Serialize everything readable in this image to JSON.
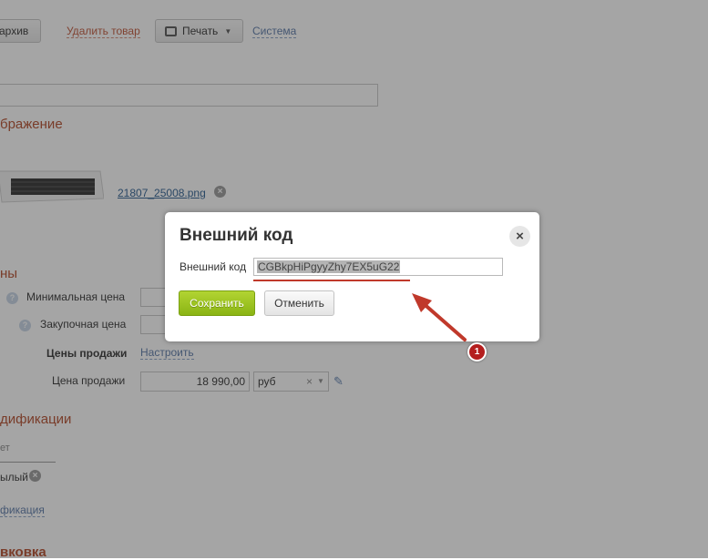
{
  "toolbar": {
    "archive_label": "архив",
    "delete_label": "Удалить товар",
    "print_label": "Печать",
    "system_label": "Система"
  },
  "form": {
    "image_section": "бражение",
    "image_filename": "21807_25008.png",
    "prices_section": "ны",
    "min_price_label": "Минимальная цена",
    "purchase_price_label": "Закупочная цена",
    "sale_prices_label": "Цены продажи",
    "configure_link": "Настроить",
    "sale_price_label": "Цена продажи",
    "sale_price_value": "18 990,00",
    "currency_value": "руб",
    "modifications_section": "дификации",
    "mod_column_header": "ет",
    "mod_item": "ылый",
    "mod_link": "фикация",
    "bottom_section": "вковка"
  },
  "dialog": {
    "title": "Внешний код",
    "field_label": "Внешний код",
    "field_value": "CGBkpHiPgyyZhy7EX5uG22",
    "save_label": "Сохранить",
    "cancel_label": "Отменить",
    "close_icon": "×"
  },
  "annotation": {
    "badge_number": "1",
    "arrow_color": "#c0392b"
  }
}
